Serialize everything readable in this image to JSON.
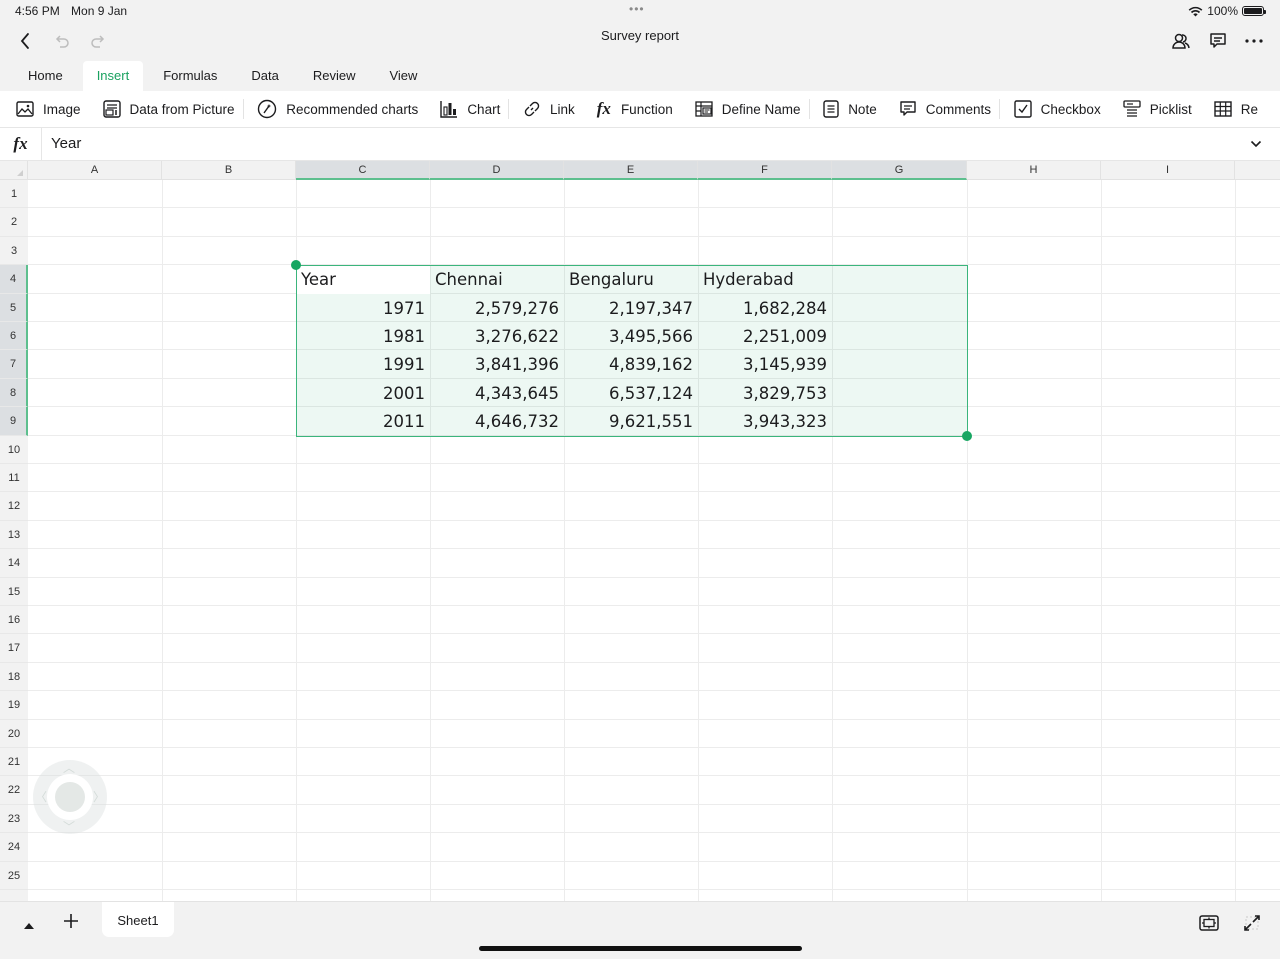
{
  "status_bar": {
    "time": "4:56 PM",
    "date": "Mon 9 Jan",
    "battery": "100%",
    "battery_level": 1.0
  },
  "title_bar": {
    "title": "Survey report",
    "icons": [
      "back-icon",
      "undo-icon",
      "redo-icon",
      "collaborate-icon",
      "comments-icon",
      "more-icon"
    ]
  },
  "tabs": [
    {
      "label": "Home",
      "active": false
    },
    {
      "label": "Insert",
      "active": true
    },
    {
      "label": "Formulas",
      "active": false
    },
    {
      "label": "Data",
      "active": false
    },
    {
      "label": "Review",
      "active": false
    },
    {
      "label": "View",
      "active": false
    }
  ],
  "ribbon": {
    "items": [
      {
        "label": "Image",
        "icon": "image-icon"
      },
      {
        "label": "Data from Picture",
        "icon": "data-from-picture-icon"
      },
      {
        "label": "Recommended charts",
        "icon": "recommended-charts-icon"
      },
      {
        "label": "Chart",
        "icon": "chart-icon"
      },
      {
        "label": "Link",
        "icon": "link-icon"
      },
      {
        "label": "Function",
        "icon": "function-icon"
      },
      {
        "label": "Define Name",
        "icon": "define-name-icon"
      },
      {
        "label": "Note",
        "icon": "note-icon"
      },
      {
        "label": "Comments",
        "icon": "comments-icon"
      },
      {
        "label": "Checkbox",
        "icon": "checkbox-icon"
      },
      {
        "label": "Picklist",
        "icon": "picklist-icon"
      },
      {
        "label": "Re",
        "icon": "table-icon"
      }
    ]
  },
  "formula_bar": {
    "fx_label": "fx",
    "value": "Year"
  },
  "grid": {
    "columns": [
      "A",
      "B",
      "C",
      "D",
      "E",
      "F",
      "G",
      "H",
      "I"
    ],
    "selected_columns": [
      "C",
      "D",
      "E",
      "F",
      "G"
    ],
    "rows": [
      "1",
      "2",
      "3",
      "4",
      "5",
      "6",
      "7",
      "8",
      "9",
      "10",
      "11",
      "12",
      "13",
      "14",
      "15",
      "16",
      "17",
      "18",
      "19",
      "20",
      "21",
      "22",
      "23",
      "24",
      "25"
    ],
    "selected_rows": [
      "4",
      "5",
      "6",
      "7",
      "8",
      "9"
    ],
    "selection": "C4:G9",
    "active_cell": "C4"
  },
  "table": {
    "headers": [
      "Year",
      "Chennai",
      "Bengaluru",
      "Hyderabad"
    ],
    "rows": [
      [
        "1971",
        "2,579,276",
        "2,197,347",
        "1,682,284"
      ],
      [
        "1981",
        "3,276,622",
        "3,495,566",
        "2,251,009"
      ],
      [
        "1991",
        "3,841,396",
        "4,839,162",
        "3,145,939"
      ],
      [
        "2001",
        "4,343,645",
        "6,537,124",
        "3,829,753"
      ],
      [
        "2011",
        "4,646,732",
        "9,621,551",
        "3,943,323"
      ]
    ]
  },
  "sheets": {
    "tabs": [
      {
        "label": "Sheet1",
        "active": true
      }
    ]
  },
  "colors": {
    "accent": "#1aa260",
    "selection_border": "#3bb57c",
    "header_selected": "#dcdfe2"
  }
}
